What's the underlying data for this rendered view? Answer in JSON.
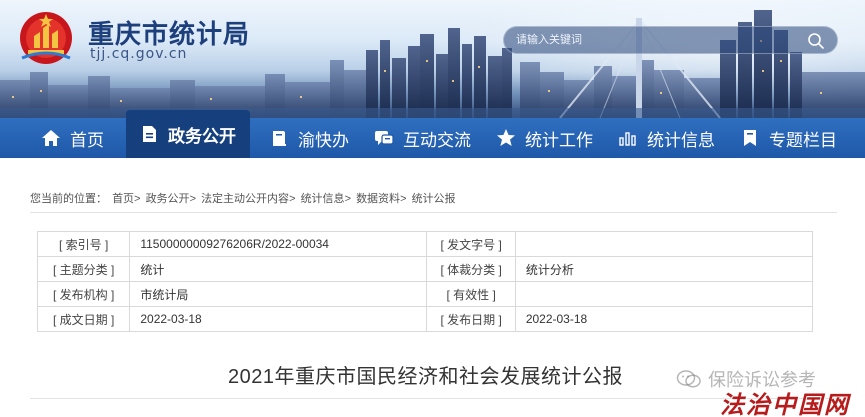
{
  "header": {
    "site_title": "重庆市统计局",
    "site_domain": "tjj.cq.gov.cn",
    "search_placeholder": "请输入关键词",
    "search_icon": "search-icon"
  },
  "nav": {
    "items": [
      {
        "label": "首页",
        "icon": "home-icon"
      },
      {
        "label": "政务公开",
        "icon": "document-icon",
        "active": true
      },
      {
        "label": "渝快办",
        "icon": "book-icon"
      },
      {
        "label": "互动交流",
        "icon": "chat-icon"
      },
      {
        "label": "统计工作",
        "icon": "star-icon"
      },
      {
        "label": "统计信息",
        "icon": "bar-chart-icon"
      },
      {
        "label": "专题栏目",
        "icon": "bookmark-icon"
      }
    ]
  },
  "breadcrumb": {
    "prefix": "您当前的位置：",
    "items": [
      "首页",
      "政务公开",
      "法定主动公开内容",
      "统计信息",
      "数据资料",
      "统计公报"
    ],
    "separator": ">"
  },
  "meta": {
    "rows": [
      {
        "label1": "[ 索引号 ]",
        "value1": "11500000009276206R/2022-00034",
        "label2": "[ 发文字号 ]",
        "value2": ""
      },
      {
        "label1": "[ 主题分类 ]",
        "value1": "统计",
        "label2": "[ 体裁分类 ]",
        "value2": "统计分析"
      },
      {
        "label1": "[ 发布机构 ]",
        "value1": "市统计局",
        "label2": "[ 有效性 ]",
        "value2": ""
      },
      {
        "label1": "[ 成文日期 ]",
        "value1": "2022-03-18",
        "label2": "[ 发布日期 ]",
        "value2": "2022-03-18"
      }
    ]
  },
  "article": {
    "title": "2021年重庆市国民经济和社会发展统计公报"
  },
  "watermarks": {
    "account": "保险诉讼参考",
    "brand": "法治中国网"
  },
  "colors": {
    "nav_bg": "#1f58a8",
    "nav_active": "#163f7e",
    "title_blue": "#1d3f7c",
    "brand_red": "#b71c1c"
  }
}
